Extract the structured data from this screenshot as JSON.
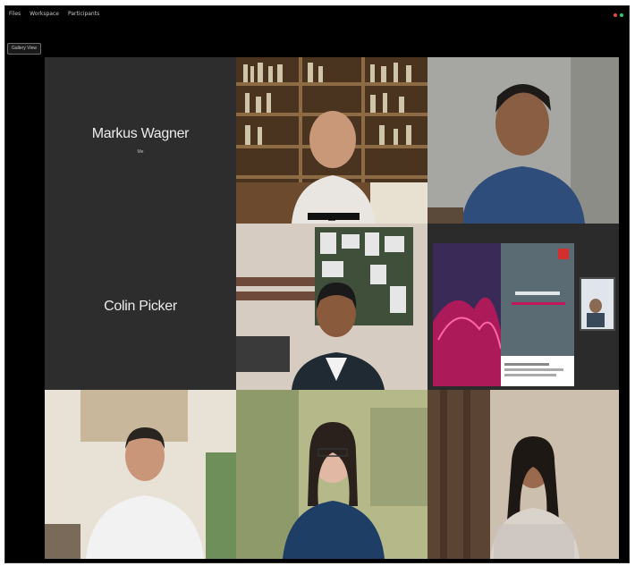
{
  "menu": {
    "items": [
      "Files",
      "Workspace",
      "Participants"
    ]
  },
  "toolbar": {
    "view_button": "Gallery View"
  },
  "participants": [
    {
      "name": "Markus Wagner",
      "subtitle": "Me",
      "video": false
    },
    {
      "name": "",
      "video": true,
      "tag": ""
    },
    {
      "name": "",
      "video": true
    },
    {
      "name": "Colin Picker",
      "video": false
    },
    {
      "name": "",
      "video": true
    },
    {
      "name": "",
      "video": true,
      "shared_screen": true
    },
    {
      "name": "",
      "video": true
    },
    {
      "name": "",
      "video": true
    },
    {
      "name": "",
      "video": true
    }
  ],
  "colors": {
    "background": "#000000",
    "empty_tile": "#2d2d2d",
    "slide_accent": "#c2185b",
    "slide_panel": "#5a6b73",
    "close_dot": "#e84c3d",
    "other_dot": "#2ecc71"
  },
  "icons": [
    "window-close-icon",
    "window-minimize-icon",
    "person-silhouette-icon"
  ]
}
